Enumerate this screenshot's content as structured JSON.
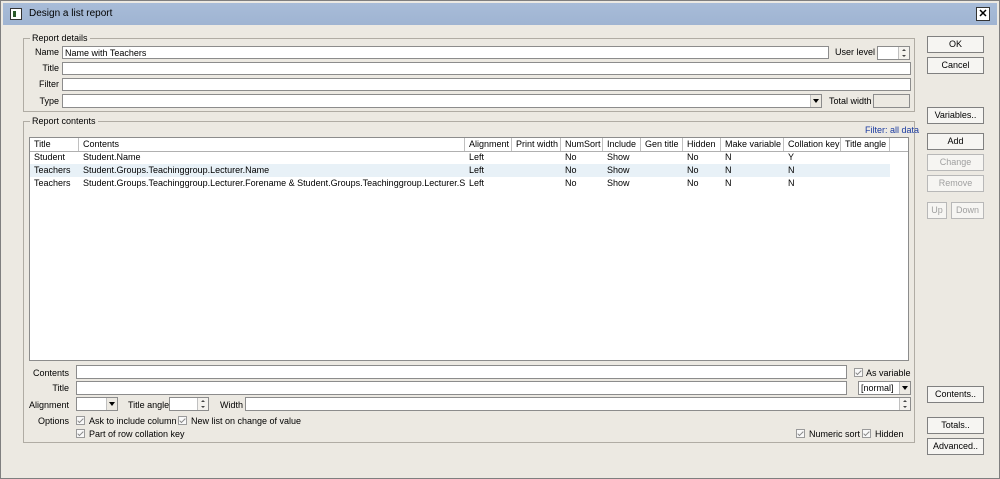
{
  "window": {
    "title": "Design a list report",
    "close_label": "✕"
  },
  "report_details": {
    "group_label": "Report details",
    "name_label": "Name",
    "name_value": "Name with Teachers",
    "title_label": "Title",
    "title_value": "",
    "filter_label": "Filter",
    "filter_value": "",
    "type_label": "Type",
    "type_value": "",
    "user_level_label": "User level",
    "user_level_value": "",
    "total_width_label": "Total width",
    "total_width_value": ""
  },
  "report_contents": {
    "group_label": "Report contents",
    "filter_link": "Filter: all data",
    "columns": [
      "Title",
      "Contents",
      "Alignment",
      "Print width",
      "NumSort",
      "Include",
      "Gen title",
      "Hidden",
      "Make variable",
      "Collation key",
      "Title angle"
    ],
    "rows": [
      {
        "title": "Student",
        "contents": "Student.Name",
        "alignment": "Left",
        "print_width": "",
        "numsort": "No",
        "include": "Show",
        "gen_title": "",
        "hidden": "No",
        "make_variable": "N",
        "collation_key": "Y",
        "title_angle": ""
      },
      {
        "title": "Teachers",
        "contents": "Student.Groups.Teachinggroup.Lecturer.Name",
        "alignment": "Left",
        "print_width": "",
        "numsort": "No",
        "include": "Show",
        "gen_title": "",
        "hidden": "No",
        "make_variable": "N",
        "collation_key": "N",
        "title_angle": ""
      },
      {
        "title": "Teachers",
        "contents": "Student.Groups.Teachinggroup.Lecturer.Forename & Student.Groups.Teachinggroup.Lecturer.Surname",
        "alignment": "Left",
        "print_width": "",
        "numsort": "No",
        "include": "Show",
        "gen_title": "",
        "hidden": "No",
        "make_variable": "N",
        "collation_key": "N",
        "title_angle": ""
      }
    ]
  },
  "editor": {
    "contents_label": "Contents",
    "contents_value": "",
    "as_variable_label": "As variable",
    "title_label": "Title",
    "title_value": "",
    "title_style_value": "[normal]",
    "alignment_label": "Alignment",
    "alignment_value": "",
    "title_angle_label": "Title angle",
    "title_angle_value": "",
    "width_label": "Width",
    "width_value": "",
    "options_label": "Options",
    "ask_include_label": "Ask to  include column",
    "new_list_label": "New list on change of value",
    "part_collation_label": "Part of row collation key",
    "numeric_sort_label": "Numeric sort",
    "hidden_label": "Hidden"
  },
  "buttons": {
    "ok": "OK",
    "cancel": "Cancel",
    "variables": "Variables..",
    "add": "Add",
    "change": "Change",
    "remove": "Remove",
    "up": "Up",
    "down": "Down",
    "contents": "Contents..",
    "totals": "Totals..",
    "advanced": "Advanced.."
  }
}
